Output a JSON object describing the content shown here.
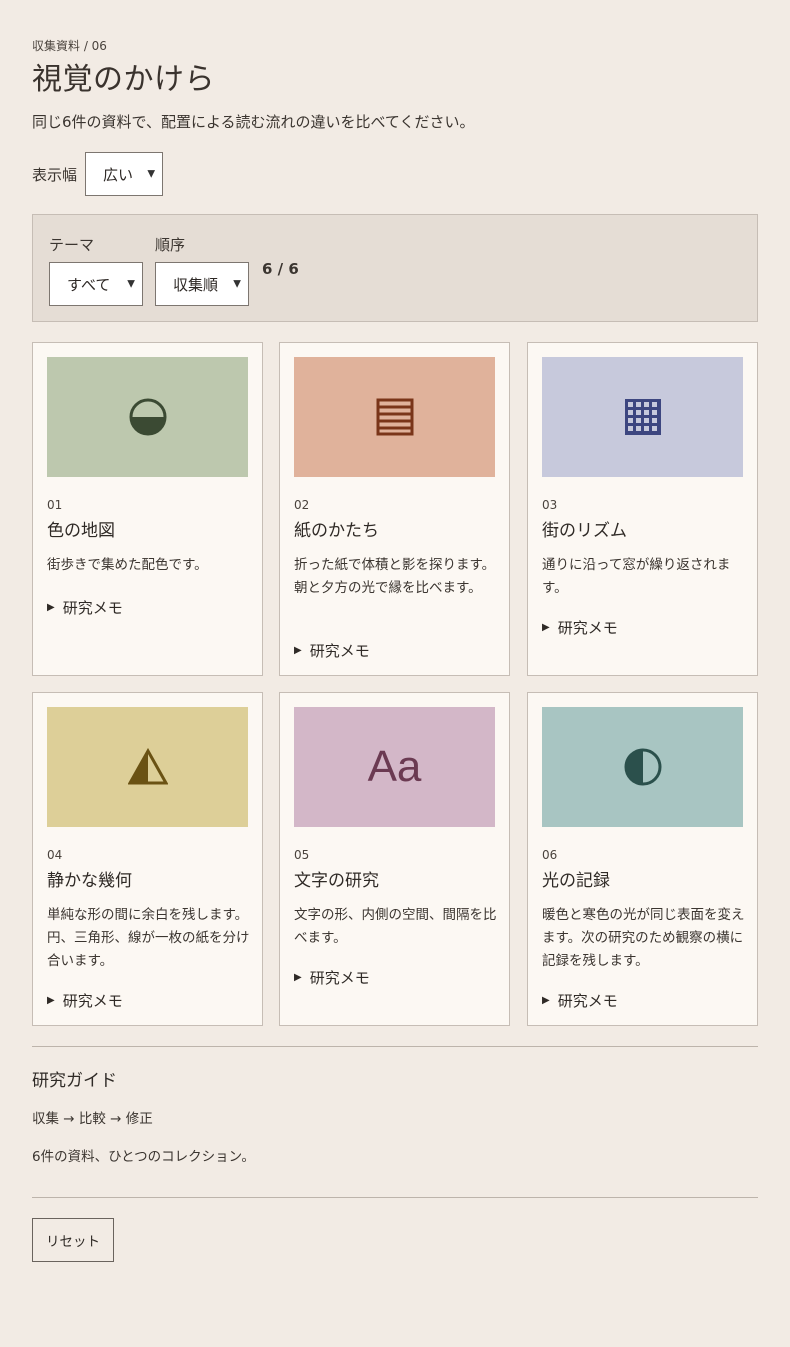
{
  "header": {
    "eyebrow": "収集資料 / 06",
    "title": "視覚のかけら",
    "lead": "同じ6件の資料で、配置による読む流れの違いを比べてください。"
  },
  "width_control": {
    "label": "表示幅",
    "value": "広い"
  },
  "filters": {
    "theme": {
      "label": "テーマ",
      "value": "すべて"
    },
    "order": {
      "label": "順序",
      "value": "収集順"
    },
    "count": "6 / 6"
  },
  "cards": [
    {
      "num": "01",
      "title": "色の地図",
      "desc": "街歩きで集めた配色です。",
      "memo": "研究メモ",
      "color": "#bdc8ae",
      "icon": "half-circle-icon",
      "glyph_color": "#3b4a33"
    },
    {
      "num": "02",
      "title": "紙のかたち",
      "desc": "折った紙で体積と影を探ります。朝と夕方の光で縁を比べます。",
      "memo": "研究メモ",
      "color": "#e0b29b",
      "icon": "stacked-lines-icon",
      "glyph_color": "#7a3519"
    },
    {
      "num": "03",
      "title": "街のリズム",
      "desc": "通りに沿って窓が繰り返されます。",
      "memo": "研究メモ",
      "color": "#c7c9dc",
      "icon": "window-grid-icon",
      "glyph_color": "#3d4680"
    },
    {
      "num": "04",
      "title": "静かな幾何",
      "desc": "単純な形の間に余白を残します。円、三角形、線が一枚の紙を分け合います。",
      "memo": "研究メモ",
      "color": "#ddcf98",
      "icon": "triangle-icon",
      "glyph_color": "#6a5213"
    },
    {
      "num": "05",
      "title": "文字の研究",
      "desc": "文字の形、内側の空間、間隔を比べます。",
      "memo": "研究メモ",
      "color": "#d3b7c8",
      "icon": "type-sample-icon",
      "glyph_color": "#6b3a52",
      "glyph_text": "Aa"
    },
    {
      "num": "06",
      "title": "光の記録",
      "desc": "暖色と寒色の光が同じ表面を変えます。次の研究のため観察の横に記録を残します。",
      "memo": "研究メモ",
      "color": "#a8c5c2",
      "icon": "half-moon-icon",
      "glyph_color": "#2b504c"
    }
  ],
  "guide": {
    "title": "研究ガイド",
    "flow": "収集 → 比較 → 修正",
    "note": "6件の資料、ひとつのコレクション。"
  },
  "reset_label": "リセット"
}
